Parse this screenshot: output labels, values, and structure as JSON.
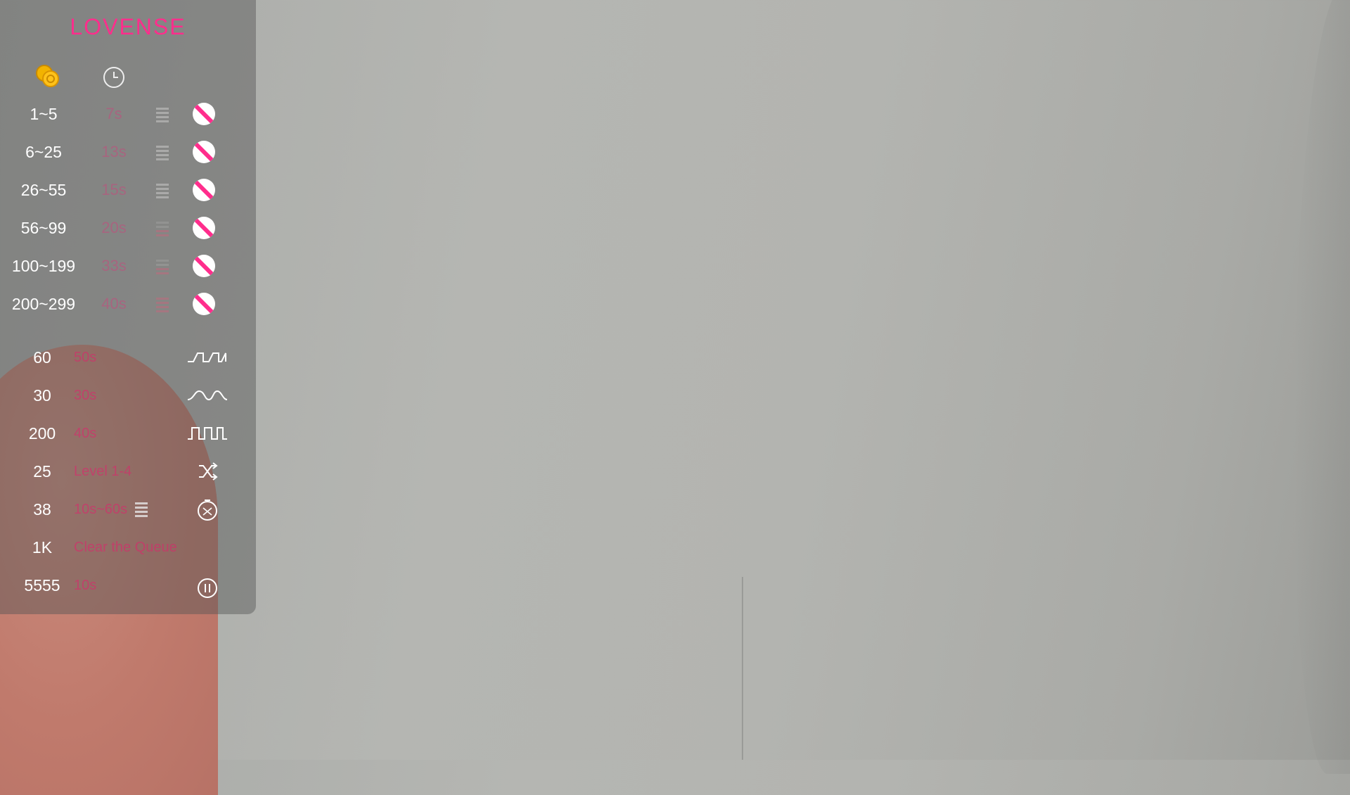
{
  "brand": {
    "logo": "LOVENSE",
    "accent": "#ff2d8c"
  },
  "header": {
    "coin_icon": "coins-icon",
    "time_icon": "clock-icon"
  },
  "levels": [
    {
      "tokens": "1~5",
      "duration": "7s"
    },
    {
      "tokens": "6~25",
      "duration": "13s"
    },
    {
      "tokens": "26~55",
      "duration": "15s"
    },
    {
      "tokens": "56~99",
      "duration": "20s"
    },
    {
      "tokens": "100~199",
      "duration": "33s"
    },
    {
      "tokens": "200~299",
      "duration": "40s"
    }
  ],
  "level_icons": [
    "vibration-level-icon",
    "disabled-icon"
  ],
  "specials": [
    {
      "tokens": "60",
      "desc": "50s",
      "icon": "pattern-pulse-icon"
    },
    {
      "tokens": "30",
      "desc": "30s",
      "icon": "pattern-wave-icon"
    },
    {
      "tokens": "200",
      "desc": "40s",
      "icon": "pattern-square-icon"
    },
    {
      "tokens": "25",
      "desc": "Level 1-4",
      "icon": "random-icon"
    },
    {
      "tokens": "38",
      "desc": "10s~60s",
      "icon": "random-time-icon"
    },
    {
      "tokens": "1K",
      "desc": "Clear the Queue",
      "icon": ""
    },
    {
      "tokens": "5555",
      "desc": "10s",
      "icon": "pause-icon"
    }
  ]
}
